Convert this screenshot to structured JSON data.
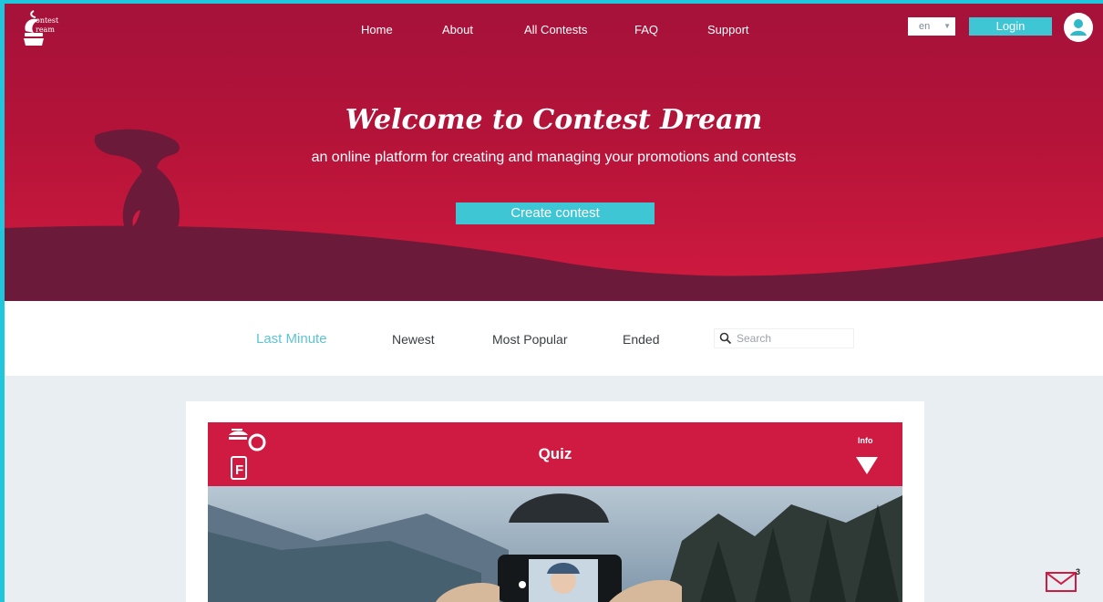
{
  "header": {
    "logo_text": [
      "ontest",
      "ream"
    ],
    "nav": [
      "Home",
      "About",
      "All Contests",
      "FAQ",
      "Support"
    ],
    "language": "en",
    "login_label": "Login"
  },
  "hero": {
    "title": "Welcome to Contest Dream",
    "subtitle": "an online platform for creating and managing your promotions and contests",
    "cta_label": "Create contest"
  },
  "filters": {
    "tabs": [
      "Last Minute",
      "Newest",
      "Most Popular",
      "Ended"
    ],
    "active_tab": "Last Minute",
    "search_placeholder": "Search"
  },
  "contest_card": {
    "title": "Quiz",
    "info_label": "Info",
    "platform_badge": "F"
  },
  "messages": {
    "count": "3"
  },
  "colors": {
    "brand_red": "#cf1a41",
    "accent_teal": "#3fc6d5",
    "hill_dark": "#6b1a3a"
  }
}
